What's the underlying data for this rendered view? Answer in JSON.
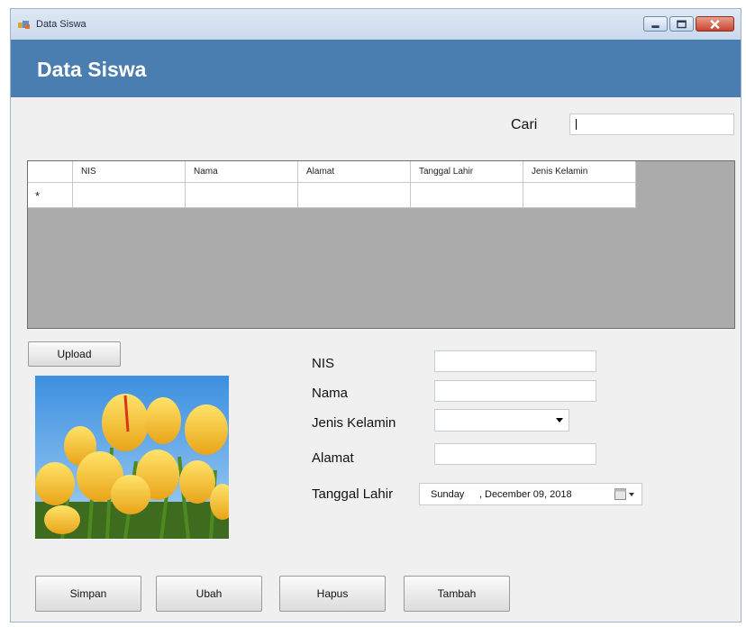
{
  "window": {
    "title": "Data Siswa",
    "controls": [
      "minimize-icon",
      "maximize-icon",
      "close-icon"
    ]
  },
  "header": {
    "title": "Data Siswa"
  },
  "search": {
    "label": "Cari",
    "value": ""
  },
  "grid": {
    "columns": [
      "NIS",
      "Nama",
      "Alamat",
      "Tanggal Lahir",
      "Jenis Kelamin"
    ],
    "new_row_marker": "*"
  },
  "upload": {
    "label": "Upload"
  },
  "photo": {
    "icon": "tulip-photo"
  },
  "form": {
    "nis_label": "NIS",
    "nama_label": "Nama",
    "jenis_kelamin_label": "Jenis Kelamin",
    "alamat_label": "Alamat",
    "tanggal_lahir_label": "Tanggal Lahir",
    "nis_value": "",
    "nama_value": "",
    "alamat_value": "",
    "date": {
      "day": "Sunday",
      "separator": ",",
      "rest": "December 09, 2018"
    }
  },
  "buttons": {
    "simpan": "Simpan",
    "ubah": "Ubah",
    "hapus": "Hapus",
    "tambah": "Tambah"
  },
  "colors": {
    "banner": "#4a7eb0",
    "window_bg": "#f0f0f0",
    "grid_bg": "#ababab"
  }
}
